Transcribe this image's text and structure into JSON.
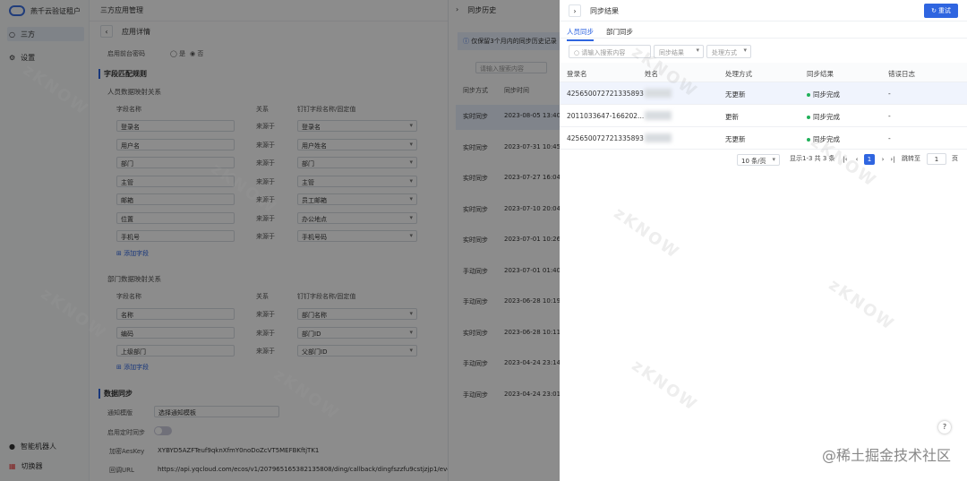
{
  "sidebar": {
    "tenant": "燕千云验证租户",
    "items": [
      {
        "label": "三方"
      },
      {
        "label": "设置"
      }
    ],
    "bottom": [
      {
        "label": "智能机器人"
      },
      {
        "label": "切换器"
      }
    ]
  },
  "main": {
    "header": "三方应用管理",
    "subheader": "应用详情",
    "enable_label": "启用前台密码",
    "radio_yes": "是",
    "radio_no": "否",
    "rule_title": "字段匹配规则",
    "person_title": "人员数据映射关系",
    "dept_title": "部门数据映射关系",
    "col_field": "字段名称",
    "col_rel": "关系",
    "col_ding": "钉钉字段名称/固定值",
    "person_rows": [
      {
        "field": "登录名",
        "rel": "来源于",
        "ding": "登录名"
      },
      {
        "field": "用户名",
        "rel": "来源于",
        "ding": "用户姓名"
      },
      {
        "field": "部门",
        "rel": "来源于",
        "ding": "部门"
      },
      {
        "field": "主管",
        "rel": "来源于",
        "ding": "主管"
      },
      {
        "field": "邮箱",
        "rel": "来源于",
        "ding": "员工邮箱"
      },
      {
        "field": "位置",
        "rel": "来源于",
        "ding": "办公地点"
      },
      {
        "field": "手机号",
        "rel": "来源于",
        "ding": "手机号码"
      }
    ],
    "add_field": "添加字段",
    "dept_rows": [
      {
        "field": "名称",
        "rel": "来源于",
        "ding": "部门名称"
      },
      {
        "field": "编码",
        "rel": "来源于",
        "ding": "部门ID"
      },
      {
        "field": "上级部门",
        "rel": "来源于",
        "ding": "父部门ID"
      }
    ],
    "sync_title": "数据同步",
    "notify_label": "通知模版",
    "notify_value": "选择通知模板",
    "timer_label": "启用定时同步",
    "aes_label": "加密AesKey",
    "aes_value": "XYBYD5AZFTeuf9qknXfmY0noDoZcVT5MEFBKftjTK1",
    "cb_label": "回调URL",
    "cb_value": "https://api.yqcloud.com/ecos/v1/207965165382135808/ding/callback/dingfszzfu9cstjzjp1/eve"
  },
  "history": {
    "title": "同步历史",
    "notice": "仅保留3个月内的同步历史记录",
    "search_placeholder": "请输入搜索内容",
    "col_method": "同步方式",
    "col_time": "同步时间",
    "rows": [
      {
        "method": "实时同步",
        "time": "2023-08-05 13:40"
      },
      {
        "method": "实时同步",
        "time": "2023-07-31 10:45"
      },
      {
        "method": "实时同步",
        "time": "2023-07-27 16:04"
      },
      {
        "method": "实时同步",
        "time": "2023-07-10 20:04"
      },
      {
        "method": "实时同步",
        "time": "2023-07-01 10:26"
      },
      {
        "method": "手动同步",
        "time": "2023-07-01 01:40"
      },
      {
        "method": "手动同步",
        "time": "2023-06-28 10:19"
      },
      {
        "method": "实时同步",
        "time": "2023-06-28 10:11"
      },
      {
        "method": "手动同步",
        "time": "2023-04-24 23:14"
      },
      {
        "method": "手动同步",
        "time": "2023-04-24 23:01"
      }
    ]
  },
  "drawer": {
    "title": "同步结果",
    "refresh": "重试",
    "tabs": [
      "人员同步",
      "部门同步"
    ],
    "search_placeholder": "请输入搜索内容",
    "filter_result": "同步结果",
    "filter_method": "处理方式",
    "columns": [
      "登录名",
      "姓名",
      "处理方式",
      "同步结果",
      "错误日志"
    ],
    "rows": [
      {
        "login": "425650072721335893",
        "method": "无更新",
        "result": "同步完成",
        "error": "-"
      },
      {
        "login": "2011033647-166202...",
        "method": "更新",
        "result": "同步完成",
        "error": "-"
      },
      {
        "login": "425650072721335893",
        "method": "无更新",
        "result": "同步完成",
        "error": "-"
      }
    ],
    "page_size": "10 条/页",
    "page_info": "显示1-3 共 3 条",
    "current_page": "1",
    "jump_label": "跳转至",
    "jump_value": "1",
    "page_unit": "页"
  },
  "watermark_text": "@稀土掘金技术社区",
  "colors": {
    "accent": "#2f65e0",
    "success": "#21b15a"
  }
}
